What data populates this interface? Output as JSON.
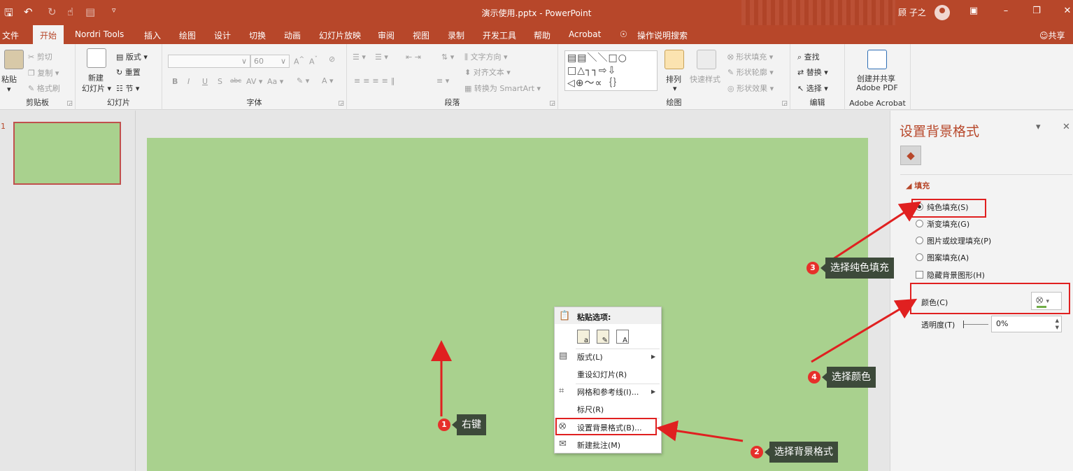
{
  "app": {
    "title": "演示使用.pptx - PowerPoint",
    "user": "顾 子之",
    "accent": "#b7472a"
  },
  "quick_access": {
    "save_icon": "save-icon",
    "undo_icon": "undo-icon",
    "redo_icon": "redo-icon",
    "touch_icon": "touch-mode-icon",
    "customize_icon": "customize-icon"
  },
  "tabs": [
    "文件",
    "开始",
    "Nordri Tools",
    "插入",
    "绘图",
    "设计",
    "切换",
    "动画",
    "幻灯片放映",
    "审阅",
    "视图",
    "录制",
    "开发工具",
    "帮助",
    "Acrobat",
    "操作说明搜索"
  ],
  "share_label": "共享",
  "ribbon": {
    "clipboard": {
      "label": "剪贴板",
      "paste": "粘贴",
      "cut": "剪切",
      "copy": "复制",
      "format_painter": "格式刷"
    },
    "slides": {
      "label": "幻灯片",
      "new_slide_line1": "新建",
      "new_slide_line2": "幻灯片",
      "layout": "版式",
      "reset": "重置",
      "section": "节"
    },
    "font": {
      "label": "字体",
      "size": "60",
      "bold": "B",
      "italic": "I",
      "underline": "U",
      "shadow": "S",
      "strike": "abc",
      "spacing": "AV",
      "case": "Aa",
      "grow": "A",
      "shrink": "A",
      "color": "A"
    },
    "paragraph": {
      "label": "段落",
      "text_direction": "文字方向",
      "align_text": "对齐文本",
      "smartart": "转换为 SmartArt"
    },
    "drawing": {
      "label": "绘图",
      "arrange": "排列",
      "quick_styles": "快速样式",
      "shape_fill": "形状填充",
      "shape_outline": "形状轮廓",
      "shape_effects": "形状效果"
    },
    "editing": {
      "label": "编辑",
      "find": "查找",
      "replace": "替换",
      "select": "选择"
    },
    "acrobat": {
      "label": "Adobe Acrobat",
      "create_line1": "创建并共享",
      "create_line2": "Adobe PDF"
    }
  },
  "slides_panel": {
    "slide_number": "1"
  },
  "context_menu": {
    "paste_options": "粘贴选项:",
    "items": [
      {
        "label": "版式(L)",
        "submenu": true
      },
      {
        "label": "重设幻灯片(R)",
        "submenu": false
      },
      {
        "label": "网格和参考线(I)...",
        "submenu": true
      },
      {
        "label": "标尺(R)",
        "submenu": false
      },
      {
        "label": "设置背景格式(B)...",
        "submenu": false
      },
      {
        "label": "新建批注(M)",
        "submenu": false
      }
    ]
  },
  "format_pane": {
    "title": "设置背景格式",
    "section": "填充",
    "options": [
      {
        "label": "纯色填充(S)",
        "selected": true
      },
      {
        "label": "渐变填充(G)",
        "selected": false
      },
      {
        "label": "图片或纹理填充(P)",
        "selected": false
      },
      {
        "label": "图案填充(A)",
        "selected": false
      }
    ],
    "hide_graphics": "隐藏背景图形(H)",
    "color_label": "颜色(C)",
    "transparency_label": "透明度(T)",
    "transparency_value": "0%",
    "fill_color": "#70ad47"
  },
  "annotations": [
    {
      "num": "1",
      "text": "右键"
    },
    {
      "num": "2",
      "text": "选择背景格式"
    },
    {
      "num": "3",
      "text": "选择纯色填充"
    },
    {
      "num": "4",
      "text": "选择颜色"
    }
  ],
  "slide": {
    "background": "#a9d18e"
  }
}
